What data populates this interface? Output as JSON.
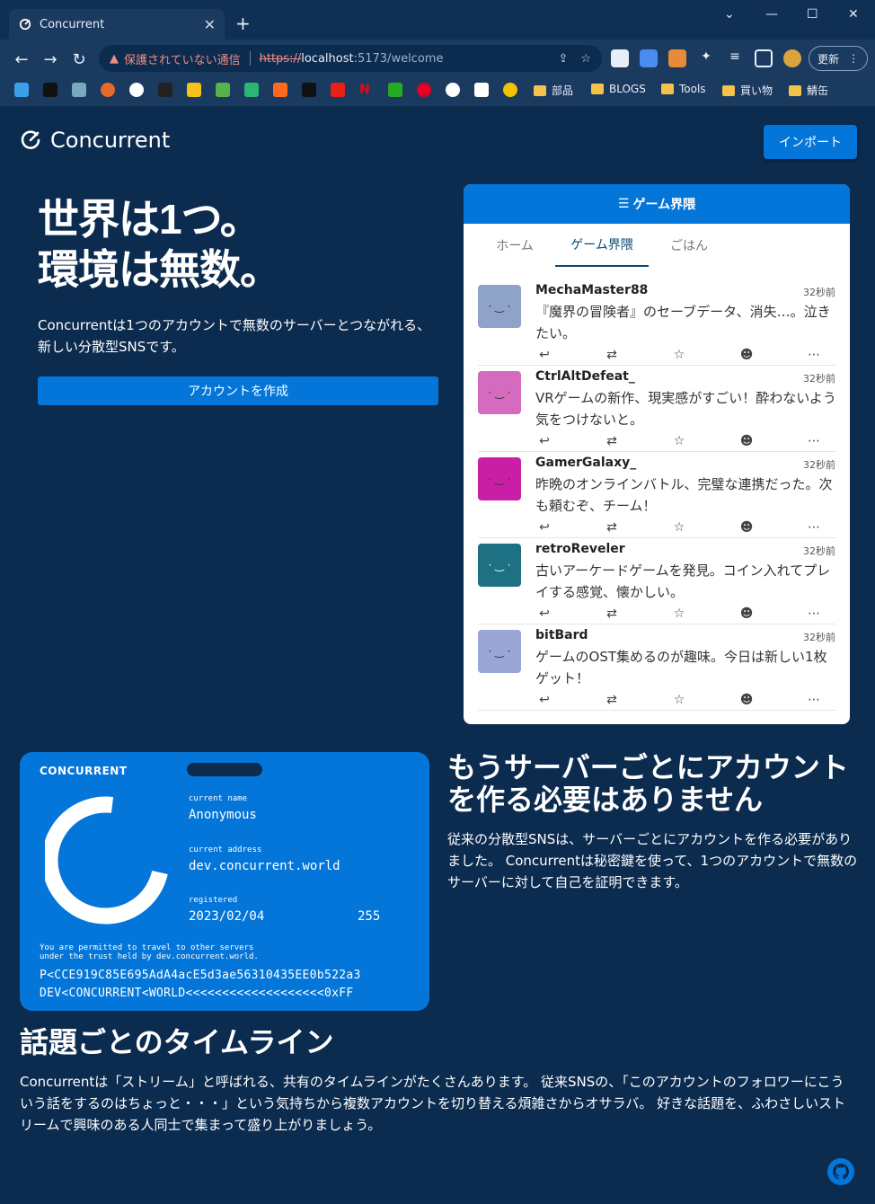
{
  "browser": {
    "tab_title": "Concurrent",
    "security_label": "保護されていない通信",
    "url_scheme": "https://",
    "url_host": "localhost",
    "url_path": ":5173/welcome",
    "update_label": "更新",
    "bookmark_folders": [
      "部品",
      "BLOGS",
      "Tools",
      "買い物",
      "鯖缶"
    ]
  },
  "header": {
    "brand": "Concurrent",
    "import_label": "インポート"
  },
  "hero": {
    "title_line1": "世界は1つ。",
    "title_line2": "環境は無数。",
    "description": "Concurrentは1つのアカウントで無数のサーバーとつながれる、新しい分散型SNSです。",
    "create_label": "アカウントを作成"
  },
  "timeline": {
    "header": "ゲーム界隈",
    "tabs": [
      "ホーム",
      "ゲーム界隈",
      "ごはん"
    ],
    "active_tab": "ゲーム界隈",
    "posts": [
      {
        "name": "MechaMaster88",
        "time": "32秒前",
        "text": "『魔界の冒険者』のセーブデータ、消失…。泣きたい。",
        "avatar_color": "#8fa3c8"
      },
      {
        "name": "CtrlAltDefeat_",
        "time": "32秒前",
        "text": "VRゲームの新作、現実感がすごい！酔わないよう気をつけないと。",
        "avatar_color": "#d46bbf"
      },
      {
        "name": "GamerGalaxy_",
        "time": "32秒前",
        "text": "昨晩のオンラインバトル、完璧な連携だった。次も頼むぞ、チーム！",
        "avatar_color": "#c81fa6"
      },
      {
        "name": "retroReveler",
        "time": "32秒前",
        "text": "古いアーケードゲームを発見。コイン入れてプレイする感覚、懐かしい。",
        "avatar_color": "#1d7183"
      },
      {
        "name": "bitBard",
        "time": "32秒前",
        "text": "ゲームのOST集めるのが趣味。今日は新しい1枚ゲット！",
        "avatar_color": "#9aa6d6"
      }
    ]
  },
  "passport": {
    "label": "CONCURRENT",
    "name_key": "current name",
    "name_value": "Anonymous",
    "address_key": "current address",
    "address_value": "dev.concurrent.world",
    "registered_key": "registered",
    "registered_value": "2023/02/04",
    "number": "255",
    "notice_line1": "You are permitted to travel to other servers",
    "notice_line2": "under the trust held by dev.concurrent.world.",
    "mrz_line1": "P<CCE919C85E695AdA4acE5d3ae56310435EE0b522a3",
    "mrz_line2": "DEV<CONCURRENT<WORLD<<<<<<<<<<<<<<<<<<<0xFF"
  },
  "section_account": {
    "title_line1": "もうサーバーごとにアカウント",
    "title_line2": "を作る必要はありません",
    "description": "従来の分散型SNSは、サーバーごとにアカウントを作る必要がありました。 Concurrentは秘密鍵を使って、1つのアカウントで無数のサーバーに対して自己を証明できます。"
  },
  "section_timeline": {
    "title": "話題ごとのタイムライン",
    "description": "Concurrentは「ストリーム」と呼ばれる、共有のタイムラインがたくさんあります。 従来SNSの、「このアカウントのフォロワーにこういう話をするのはちょっと・・・」という気持ちから複数アカウントを切り替える煩雑さからオサラバ。 好きな話題を、ふわさしいストリームで興味のある人同士で集まって盛り上がりましょう。"
  }
}
